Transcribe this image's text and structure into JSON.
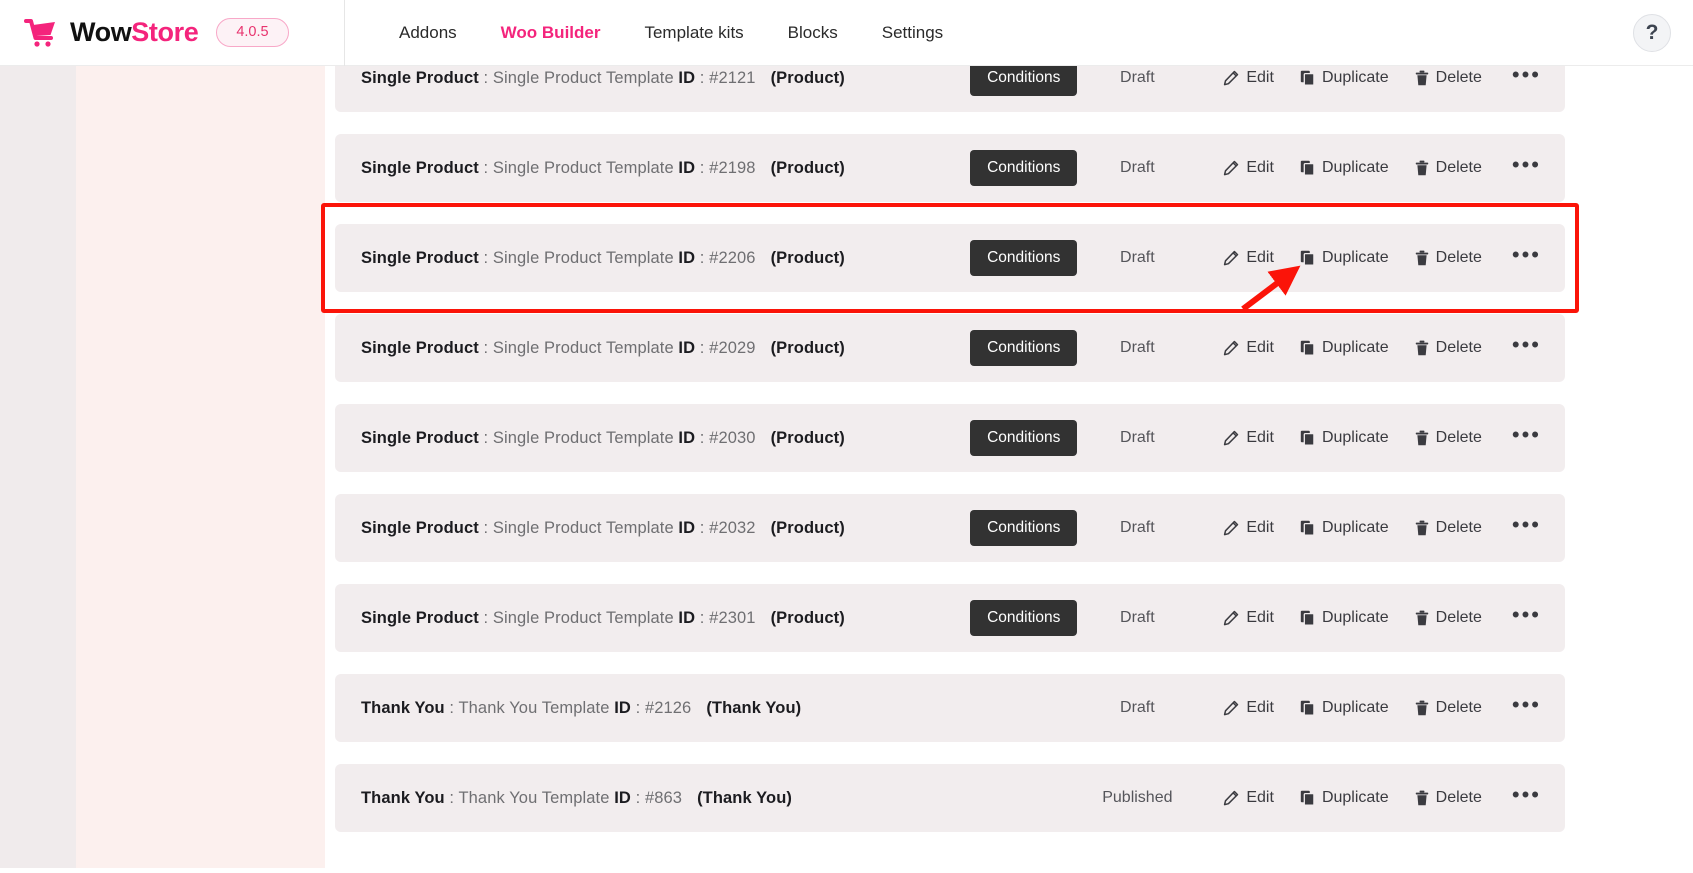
{
  "header": {
    "brand_first": "Wow",
    "brand_second": "Store",
    "version": "4.0.5",
    "logo_icon": "shopping-cart-icon",
    "help_icon": "question-mark-help-icon",
    "help_label": "?",
    "accent_color": "#f4247c",
    "nav": [
      {
        "label": "Addons",
        "active": false
      },
      {
        "label": "Woo Builder",
        "active": true
      },
      {
        "label": "Template kits",
        "active": false
      },
      {
        "label": "Blocks",
        "active": false
      },
      {
        "label": "Settings",
        "active": false
      }
    ]
  },
  "actions": {
    "conditions_label": "Conditions",
    "edit_label": "Edit",
    "duplicate_label": "Duplicate",
    "delete_label": "Delete",
    "more_label": "•••",
    "edit_icon": "pencil-edit-icon",
    "duplicate_icon": "copy-duplicate-icon",
    "delete_icon": "trash-delete-icon",
    "more_icon": "ellipsis-more-icon"
  },
  "status_labels": {
    "draft": "Draft",
    "published": "Published"
  },
  "annotation": {
    "highlight_color": "#fb1409",
    "highlight_target_row_index": 2,
    "arrow_points_to": "edit-button-row-2206"
  },
  "rows": [
    {
      "type": "Single Product",
      "template_label": "Single Product Template",
      "id_label": "ID",
      "id": "#2121",
      "post_type": "(Product)",
      "has_conditions": true,
      "status": "Draft",
      "highlighted": false
    },
    {
      "type": "Single Product",
      "template_label": "Single Product Template",
      "id_label": "ID",
      "id": "#2198",
      "post_type": "(Product)",
      "has_conditions": true,
      "status": "Draft",
      "highlighted": false
    },
    {
      "type": "Single Product",
      "template_label": "Single Product Template",
      "id_label": "ID",
      "id": "#2206",
      "post_type": "(Product)",
      "has_conditions": true,
      "status": "Draft",
      "highlighted": true
    },
    {
      "type": "Single Product",
      "template_label": "Single Product Template",
      "id_label": "ID",
      "id": "#2029",
      "post_type": "(Product)",
      "has_conditions": true,
      "status": "Draft",
      "highlighted": false
    },
    {
      "type": "Single Product",
      "template_label": "Single Product Template",
      "id_label": "ID",
      "id": "#2030",
      "post_type": "(Product)",
      "has_conditions": true,
      "status": "Draft",
      "highlighted": false
    },
    {
      "type": "Single Product",
      "template_label": "Single Product Template",
      "id_label": "ID",
      "id": "#2032",
      "post_type": "(Product)",
      "has_conditions": true,
      "status": "Draft",
      "highlighted": false
    },
    {
      "type": "Single Product",
      "template_label": "Single Product Template",
      "id_label": "ID",
      "id": "#2301",
      "post_type": "(Product)",
      "has_conditions": true,
      "status": "Draft",
      "highlighted": false
    },
    {
      "type": "Thank You",
      "template_label": "Thank You Template",
      "id_label": "ID",
      "id": "#2126",
      "post_type": "(Thank You)",
      "has_conditions": false,
      "status": "Draft",
      "highlighted": false
    },
    {
      "type": "Thank You",
      "template_label": "Thank You Template",
      "id_label": "ID",
      "id": "#863",
      "post_type": "(Thank You)",
      "has_conditions": false,
      "status": "Published",
      "highlighted": false
    }
  ]
}
